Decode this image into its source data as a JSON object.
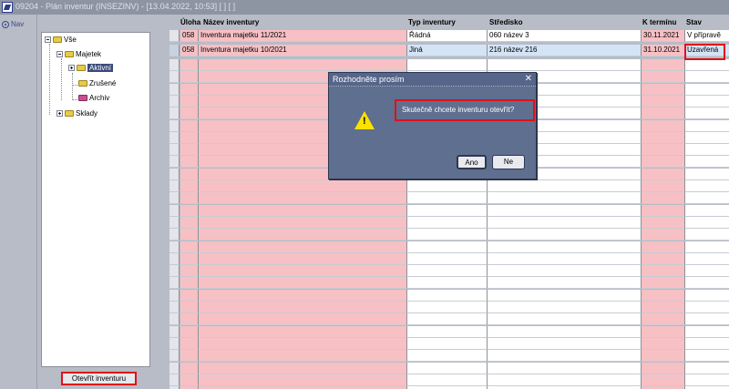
{
  "window": {
    "title": "09204 - Plán inventur (INSEZINV) - [13.04.2022, 10:53]  [ ]  [ ]"
  },
  "left_nav": {
    "label": "Nav"
  },
  "tree": {
    "root": "Vše",
    "majetek": "Majetek",
    "aktivni": "Aktivní",
    "zrusene": "Zrušené",
    "archiv": "Archiv",
    "sklady": "Sklady"
  },
  "open_button": "Otevřít inventuru",
  "grid": {
    "headers": {
      "uloha": "Úloha",
      "nazev": "Název inventury",
      "typ": "Typ inventury",
      "stredisko": "Středisko",
      "termin": "K termínu",
      "stav": "Stav"
    },
    "rows": [
      {
        "uloha": "058",
        "nazev": "Inventura majetku 11/2021",
        "typ": "Řádná",
        "stredisko": "060 název 3",
        "termin": "30.11.2021",
        "stav": "V přípravě"
      },
      {
        "uloha": "058",
        "nazev": "Inventura majetku 10/2021",
        "typ": "Jiná",
        "stredisko": "216 název 216",
        "termin": "31.10.2021",
        "stav": "Uzavřená"
      }
    ]
  },
  "dialog": {
    "title": "Rozhodněte prosím",
    "close": "✕",
    "message": "Skutečně chcete inventuru otevřít?",
    "yes": "Ano",
    "no": "Ne"
  }
}
